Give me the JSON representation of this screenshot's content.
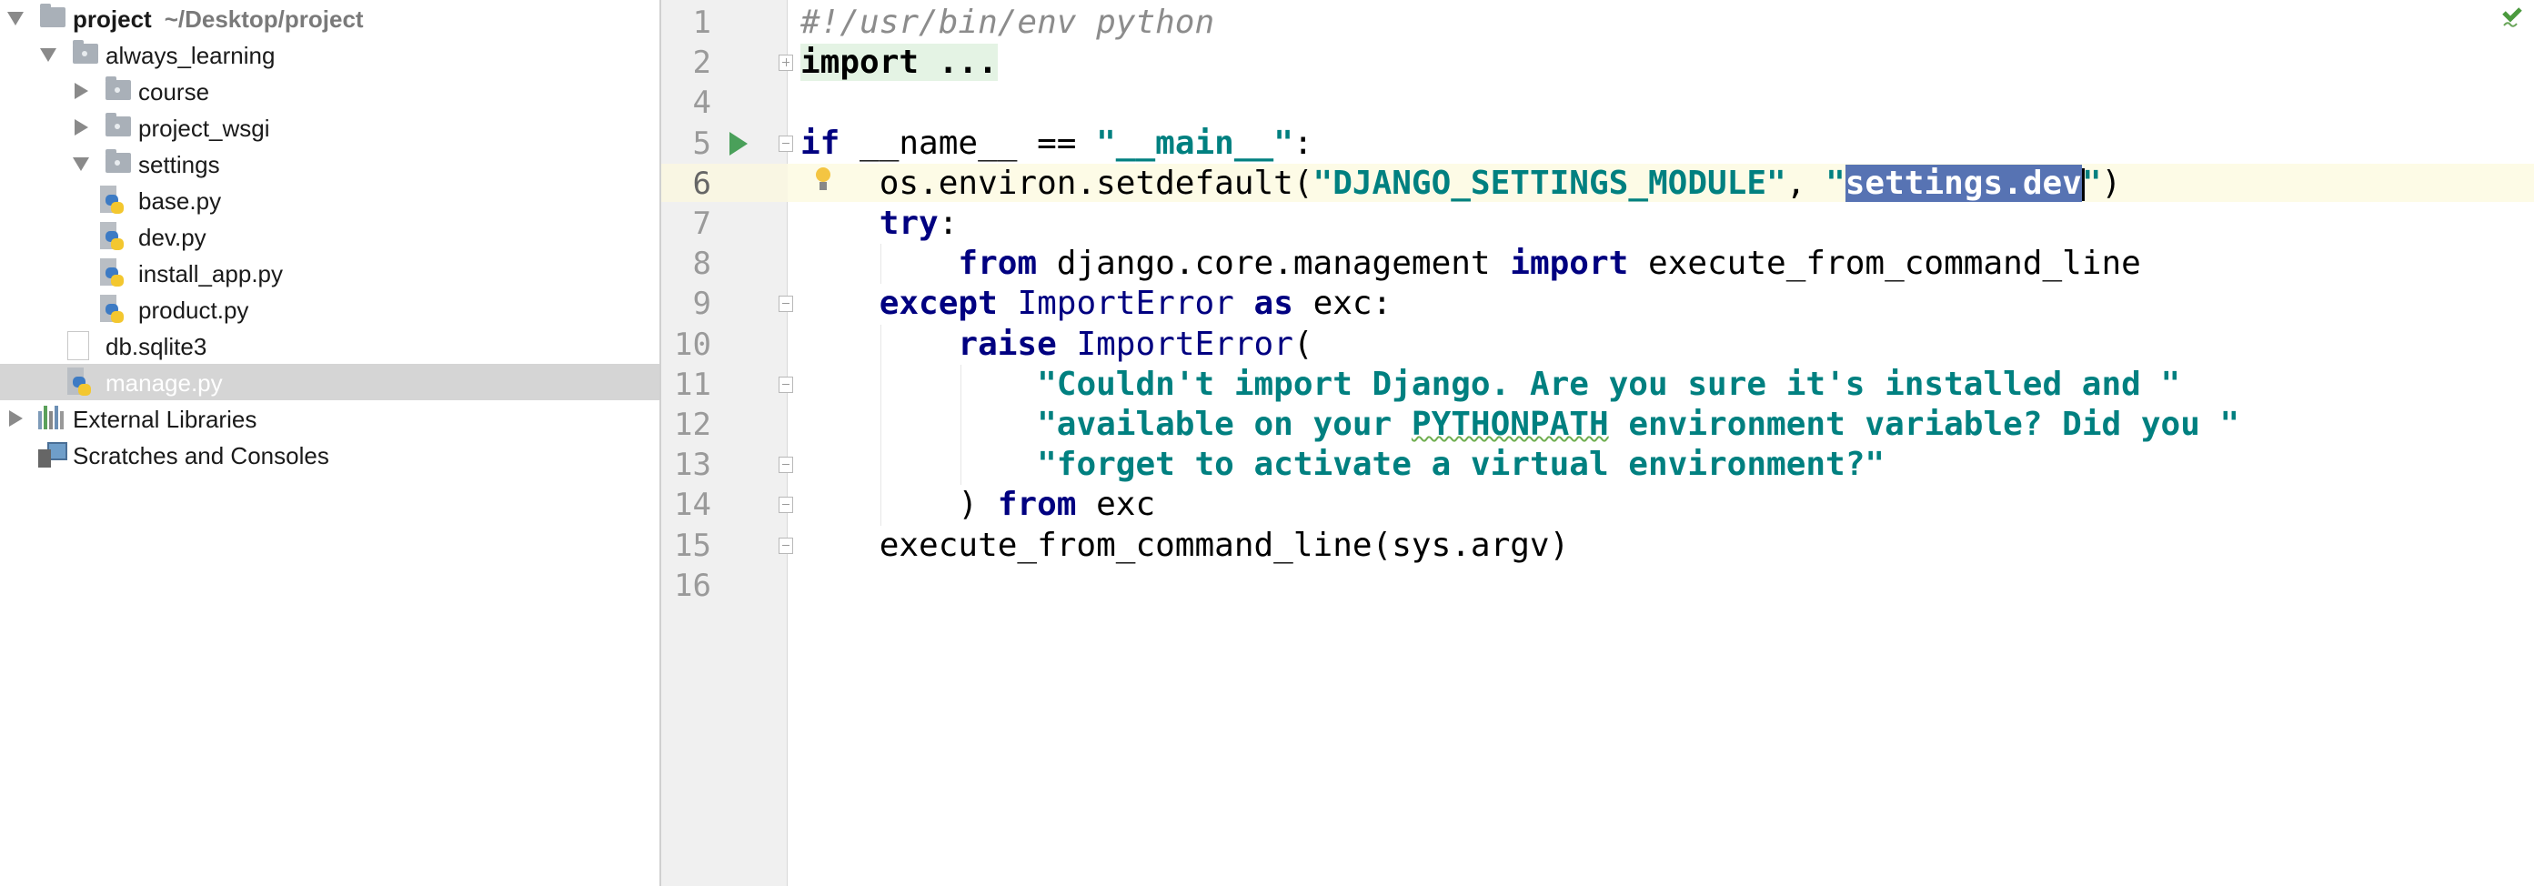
{
  "project_tree": {
    "items": [
      {
        "label": "project",
        "path": "~/Desktop/project",
        "type": "folder",
        "expanded": true
      },
      {
        "label": "always_learning",
        "type": "package",
        "expanded": true
      },
      {
        "label": "course",
        "type": "package",
        "expanded": false
      },
      {
        "label": "project_wsgi",
        "type": "package",
        "expanded": false
      },
      {
        "label": "settings",
        "type": "package",
        "expanded": true
      },
      {
        "label": "base.py",
        "type": "python-file"
      },
      {
        "label": "dev.py",
        "type": "python-file"
      },
      {
        "label": "install_app.py",
        "type": "python-file"
      },
      {
        "label": "product.py",
        "type": "python-file"
      },
      {
        "label": "db.sqlite3",
        "type": "file"
      },
      {
        "label": "manage.py",
        "type": "python-file",
        "selected": true
      },
      {
        "label": "External Libraries",
        "type": "libraries",
        "expanded": false
      },
      {
        "label": "Scratches and Consoles",
        "type": "scratches"
      }
    ]
  },
  "editor": {
    "line_numbers": [
      "1",
      "2",
      "4",
      "5",
      "6",
      "7",
      "8",
      "9",
      "10",
      "11",
      "12",
      "13",
      "14",
      "15",
      "16"
    ],
    "current_line": "6",
    "selected_text": "settings.dev",
    "colors": {
      "keyword": "#000080",
      "string": "#008080",
      "comment": "#8c8c8c",
      "selection": "#5773b3",
      "current_line": "#fdfbe6"
    },
    "lines": [
      [
        {
          "t": "#!/usr/bin/env python",
          "c": "cm"
        }
      ],
      [
        {
          "t": "import",
          "c": "fold"
        },
        {
          "t": " ...",
          "c": "fold"
        }
      ],
      [],
      [
        {
          "t": "if",
          "c": "kw"
        },
        {
          "t": " __name__ == ",
          "c": ""
        },
        {
          "t": "\"__main__\"",
          "c": "st"
        },
        {
          "t": ":",
          "c": ""
        }
      ],
      [
        {
          "t": "    os.environ.setdefault(",
          "c": ""
        },
        {
          "t": "\"DJANGO_SETTINGS_MODULE\"",
          "c": "st"
        },
        {
          "t": ", ",
          "c": ""
        },
        {
          "t": "\"",
          "c": "st"
        },
        {
          "t": "settings.dev",
          "c": "st sel"
        },
        {
          "t": "\"",
          "c": "st"
        },
        {
          "t": ")",
          "c": ""
        }
      ],
      [
        {
          "t": "    ",
          "c": ""
        },
        {
          "t": "try",
          "c": "kw"
        },
        {
          "t": ":",
          "c": ""
        }
      ],
      [
        {
          "t": "        ",
          "c": ""
        },
        {
          "t": "from",
          "c": "kw"
        },
        {
          "t": " django.core.management ",
          "c": ""
        },
        {
          "t": "import",
          "c": "kw"
        },
        {
          "t": " execute_from_command_line",
          "c": ""
        }
      ],
      [
        {
          "t": "    ",
          "c": ""
        },
        {
          "t": "except",
          "c": "kw"
        },
        {
          "t": " ",
          "c": ""
        },
        {
          "t": "ImportError",
          "c": "bi"
        },
        {
          "t": " ",
          "c": ""
        },
        {
          "t": "as",
          "c": "kw"
        },
        {
          "t": " exc:",
          "c": ""
        }
      ],
      [
        {
          "t": "        ",
          "c": ""
        },
        {
          "t": "raise",
          "c": "kw"
        },
        {
          "t": " ",
          "c": ""
        },
        {
          "t": "ImportError",
          "c": "bi"
        },
        {
          "t": "(",
          "c": ""
        }
      ],
      [
        {
          "t": "            ",
          "c": ""
        },
        {
          "t": "\"Couldn't import Django. Are you sure it's installed and \"",
          "c": "st"
        }
      ],
      [
        {
          "t": "            ",
          "c": ""
        },
        {
          "t": "\"available on your ",
          "c": "st"
        },
        {
          "t": "PYTHONPATH",
          "c": "st warn"
        },
        {
          "t": " environment variable? Did you \"",
          "c": "st"
        }
      ],
      [
        {
          "t": "            ",
          "c": ""
        },
        {
          "t": "\"forget to activate a virtual environment?\"",
          "c": "st"
        }
      ],
      [
        {
          "t": "        ) ",
          "c": ""
        },
        {
          "t": "from",
          "c": "kw"
        },
        {
          "t": " exc",
          "c": ""
        }
      ],
      [
        {
          "t": "    execute_from_command_line(sys.argv)",
          "c": ""
        }
      ],
      []
    ]
  },
  "icons": {
    "run": "run-arrow-icon",
    "intention": "lightbulb-icon",
    "inspection_ok": "check-icon"
  }
}
